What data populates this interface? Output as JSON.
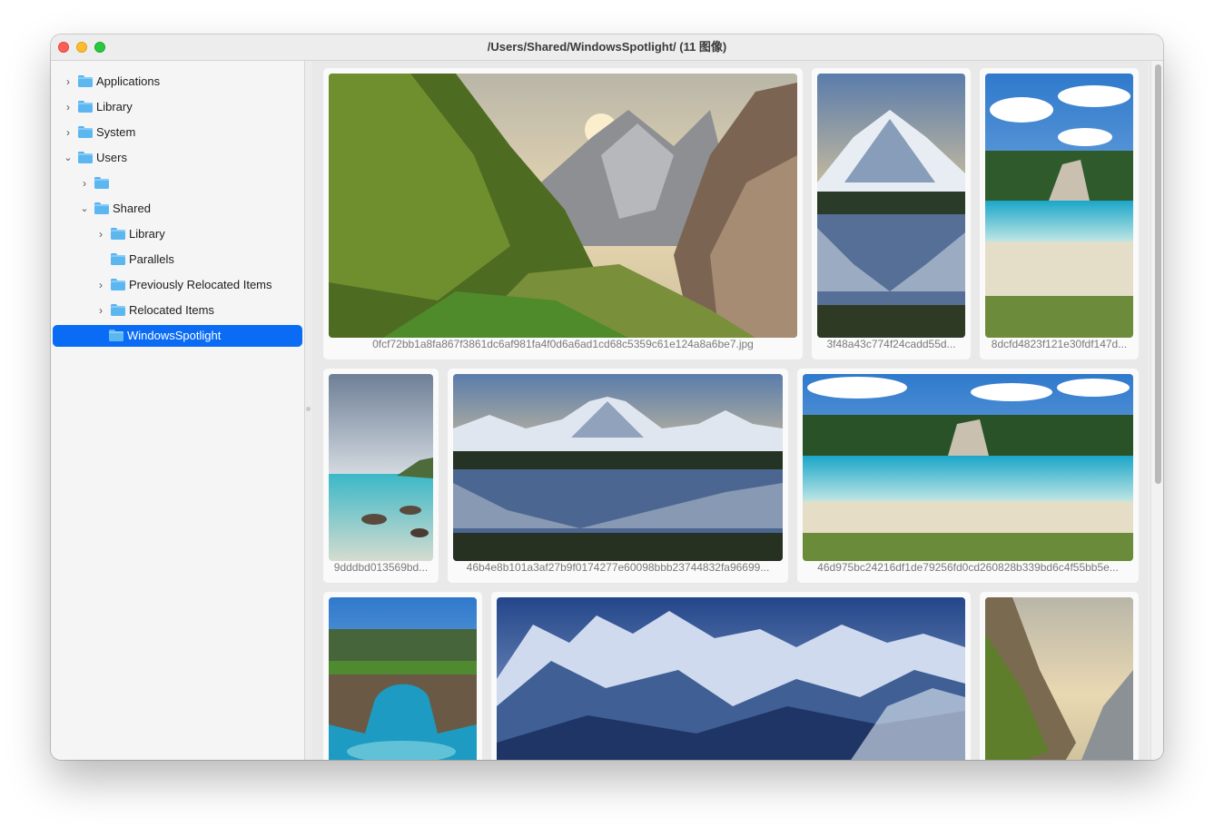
{
  "window": {
    "title": "/Users/Shared/WindowsSpotlight/ (11 图像)"
  },
  "colors": {
    "selection": "#0a6cf5",
    "folder": "#5cb7f1",
    "close": "#fe5f57",
    "minimize": "#febc2e",
    "maximize": "#28c840"
  },
  "sidebar": {
    "items": [
      {
        "label": "Applications",
        "expanded": false
      },
      {
        "label": "Library",
        "expanded": false
      },
      {
        "label": "System",
        "expanded": false
      },
      {
        "label": "Users",
        "expanded": true
      },
      {
        "label": "",
        "expanded": false
      },
      {
        "label": "Shared",
        "expanded": true
      },
      {
        "label": "Library",
        "expanded": false
      },
      {
        "label": "Parallels",
        "expanded": false
      },
      {
        "label": "Previously Relocated Items",
        "expanded": false
      },
      {
        "label": "Relocated Items",
        "expanded": false
      },
      {
        "label": "WindowsSpotlight",
        "expanded": false,
        "selected": true
      }
    ]
  },
  "gallery": {
    "images": [
      {
        "name": "0fcf72bb1a8fa867f3861dc6af981fa4f0d6a6ad1cd68c5359c61e124a8a6be7.jpg",
        "caption": "0fcf72bb1a8fa867f3861dc6af981fa4f0d6a6ad1cd68c5359c61e124a8a6be7.jpg"
      },
      {
        "name": "3f48a43c774f24cadd55d...",
        "caption": "3f48a43c774f24cadd55d..."
      },
      {
        "name": "8dcfd4823f121e30fdf147d...",
        "caption": "8dcfd4823f121e30fdf147d..."
      },
      {
        "name": "9dddbd013569bd...",
        "caption": "9dddbd013569bd..."
      },
      {
        "name": "46b4e8b101a3af27b9f0174277e60098bbb23744832fa96699...",
        "caption": "46b4e8b101a3af27b9f0174277e60098bbb23744832fa96699..."
      },
      {
        "name": "46d975bc24216df1de79256fd0cd260828b339bd6c4f55bb5e...",
        "caption": "46d975bc24216df1de79256fd0cd260828b339bd6c4f55bb5e..."
      },
      {
        "name": "",
        "caption": ""
      },
      {
        "name": "",
        "caption": ""
      },
      {
        "name": "",
        "caption": ""
      }
    ]
  }
}
